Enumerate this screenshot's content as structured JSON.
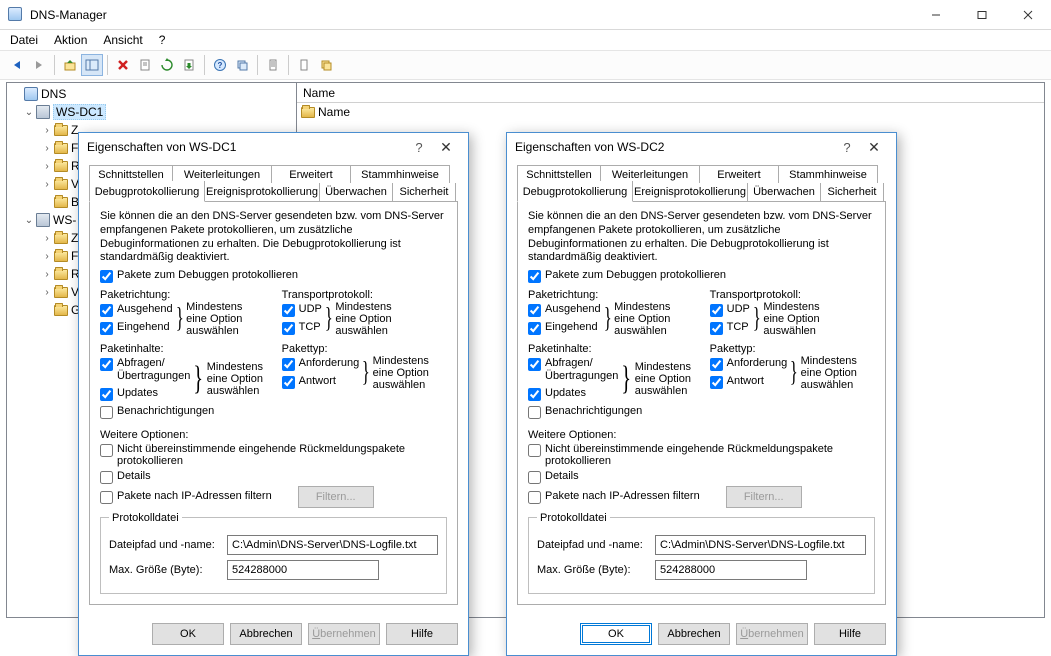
{
  "window": {
    "title": "DNS-Manager"
  },
  "menu": {
    "file": "Datei",
    "action": "Aktion",
    "view": "Ansicht",
    "help": "?"
  },
  "listpanel": {
    "header": "Name",
    "row0": "Name"
  },
  "tree": {
    "root": "DNS",
    "srv1": "WS-DC1",
    "srv2": "WS-DC2",
    "z": "Z",
    "f": "F",
    "r": "R",
    "g": "G",
    "v": "V"
  },
  "tabs": {
    "row1": {
      "a": "Schnittstellen",
      "b": "Weiterleitungen",
      "c": "Erweitert",
      "d": "Stammhinweise"
    },
    "row2": {
      "a": "Debugprotokollierung",
      "b": "Ereignisprotokollierung",
      "c": "Überwachen",
      "d": "Sicherheit"
    }
  },
  "dlg": {
    "title1": "Eigenschaften von WS-DC1",
    "title2": "Eigenschaften von WS-DC2",
    "descr": "Sie können die an den DNS-Server gesendeten bzw. vom DNS-Server empfangenen Pakete protokollieren, um zusätzliche Debuginformationen zu erhalten. Die Debugprotokollierung ist standardmäßig deaktiviert.",
    "cbDebug": "Pakete zum Debuggen protokollieren",
    "dir": "Paketrichtung:",
    "out": "Ausgehend",
    "in": "Eingehend",
    "trans": "Transportprotokoll:",
    "udp": "UDP",
    "tcp": "TCP",
    "content": "Paketinhalte:",
    "query": "Abfragen/\nÜbertragungen",
    "updates": "Updates",
    "notify": "Benachrichtigungen",
    "ptype": "Pakettyp:",
    "req": "Anforderung",
    "resp": "Antwort",
    "hint": "Mindestens eine Option auswählen",
    "more": "Weitere Optionen:",
    "unmatched": "Nicht übereinstimmende eingehende Rückmeldungspakete protokollieren",
    "details": "Details",
    "ipfilter": "Pakete nach IP-Adressen filtern",
    "filterbtn": "Filtern...",
    "fset": "Protokolldatei",
    "path": "Dateipfad und -name:",
    "size": "Max. Größe (Byte):",
    "pathVal": "C:\\Admin\\DNS-Server\\DNS-Logfile.txt",
    "sizeVal": "524288000",
    "ok": "OK",
    "cancel": "Abbrechen",
    "apply": "Übernehmen",
    "help": "Hilfe"
  }
}
